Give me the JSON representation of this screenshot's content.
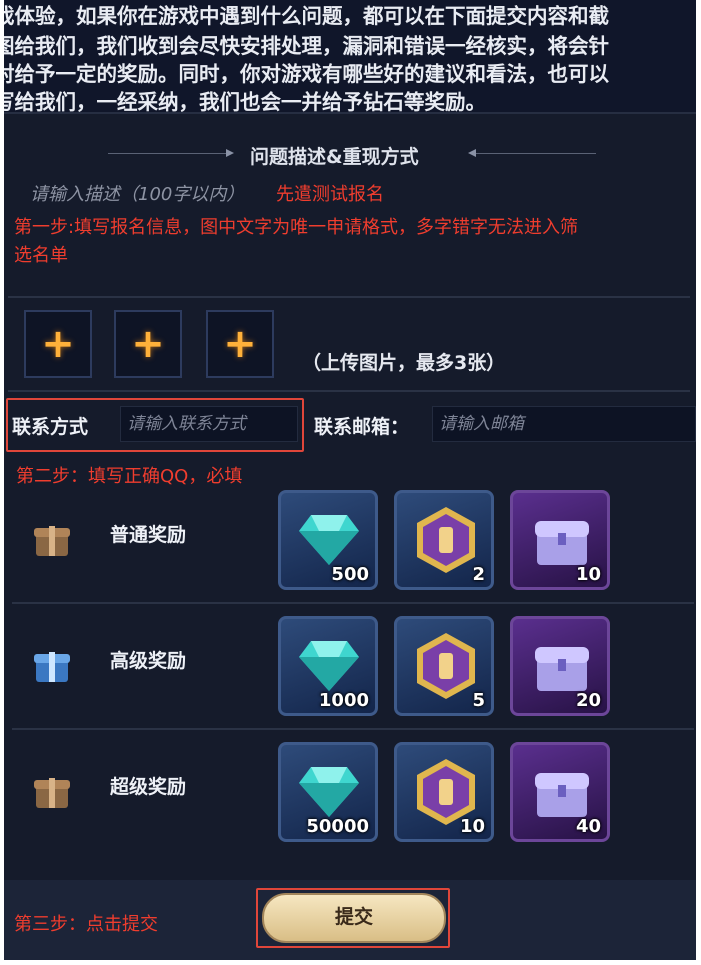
{
  "intro": {
    "lines": [
      "戏体验，如果你在游戏中遇到什么问题，都可以在下面提交内容和截",
      "图给我们，我们收到会尽快安排处理，漏洞和错误一经核实，将会针",
      "对给予一定的奖励。同时，你对游戏有哪些好的建议和看法，也可以",
      "写给我们，一经采纳，我们也会一并给予钻石等奖励。"
    ]
  },
  "section_title": "问题描述&重现方式",
  "description": {
    "placeholder": "请输入描述（100字以内）",
    "note": "先遣测试报名"
  },
  "annotations": {
    "step1_line1": "第一步:填写报名信息，图中文字为唯一申请格式，多字错字无法进入筛",
    "step1_line2": "选名单",
    "step2": "第二步：填写正确QQ，必填",
    "step3": "第三步：点击提交"
  },
  "upload": {
    "slots": [
      "+",
      "+",
      "+"
    ],
    "hint": "（上传图片，最多3张）"
  },
  "contact": {
    "label": "联系方式",
    "placeholder": "请输入联系方式",
    "email_label": "联系邮箱：",
    "email_placeholder": "请输入邮箱"
  },
  "rewards": [
    {
      "name": "普通奖励",
      "gift_color": "bronze",
      "items": [
        {
          "icon": "diamond-icon",
          "count": "500"
        },
        {
          "icon": "badge-icon",
          "count": "2"
        },
        {
          "icon": "chest-icon",
          "count": "10"
        }
      ]
    },
    {
      "name": "高级奖励",
      "gift_color": "blue",
      "items": [
        {
          "icon": "diamond-icon",
          "count": "1000"
        },
        {
          "icon": "badge-icon",
          "count": "5"
        },
        {
          "icon": "chest-icon",
          "count": "20"
        }
      ]
    },
    {
      "name": "超级奖励",
      "gift_color": "bronze",
      "items": [
        {
          "icon": "diamond-icon",
          "count": "50000"
        },
        {
          "icon": "badge-icon",
          "count": "10"
        },
        {
          "icon": "chest-icon",
          "count": "40"
        }
      ]
    }
  ],
  "submit_label": "提交",
  "colors": {
    "panel_bg": "#151b2b",
    "annotation_red": "#ef3d2e",
    "upload_plus": "#ffb13a",
    "button_gold": "#e6d2a2"
  }
}
